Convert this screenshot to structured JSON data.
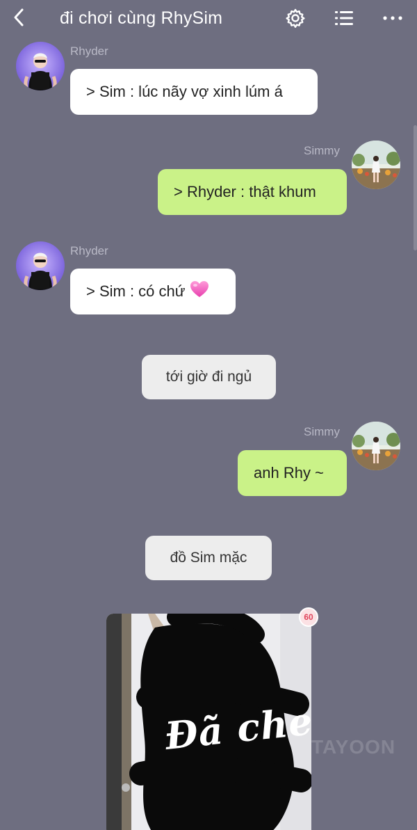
{
  "header": {
    "title": "đi chơi cùng RhySim",
    "icons": [
      "back-arrow-icon",
      "gear-icon",
      "list-icon",
      "more-icon"
    ]
  },
  "messages": [
    {
      "type": "incoming",
      "sender": "Rhyder",
      "text": "> Sim : lúc nãy vợ xinh lúm á"
    },
    {
      "type": "outgoing",
      "sender": "Simmy",
      "text": "> Rhyder : thật khum"
    },
    {
      "type": "incoming",
      "sender": "Rhyder",
      "text": "> Sim : có chứ",
      "emoji": "pink-heart"
    },
    {
      "type": "system",
      "text": "tới giờ đi ngủ"
    },
    {
      "type": "outgoing",
      "sender": "Simmy",
      "text": "anh Rhy ~"
    },
    {
      "type": "system",
      "text": "đồ Sim mặc"
    },
    {
      "type": "image",
      "overlay_text": "Đã che",
      "badge": "60"
    }
  ],
  "watermark": "TAYOON",
  "colors": {
    "background": "#6e6e80",
    "incoming_bubble": "#ffffff",
    "outgoing_bubble": "#caf288",
    "system_bubble": "#ededed",
    "badge": "#e0435a"
  }
}
